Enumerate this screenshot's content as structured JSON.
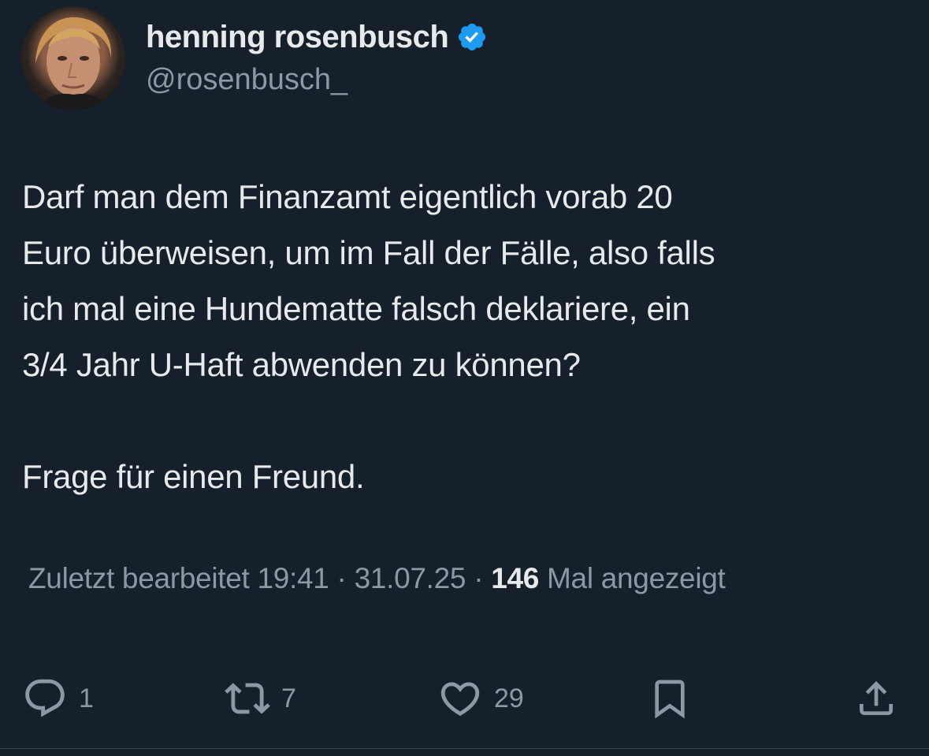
{
  "author": {
    "display_name": "henning rosenbusch",
    "handle": "@rosenbusch_",
    "verified_icon": "verified-badge-icon",
    "badge_color": "#1d9bf0"
  },
  "tweet": {
    "text": "Darf man dem Finanzamt eigentlich vorab 20\nEuro überweisen, um im Fall der Fälle, also falls\nich mal eine Hundematte falsch deklariere, ein\n3/4 Jahr U-Haft abwenden zu können?\n\nFrage für einen Freund."
  },
  "meta": {
    "edited_label": "Zuletzt bearbeitet",
    "time": "19:41",
    "date": "31.07.25",
    "views_count": "146",
    "views_label": "Mal angezeigt"
  },
  "actions": {
    "reply_count": "1",
    "retweet_count": "7",
    "like_count": "29"
  },
  "colors": {
    "background": "#15202b",
    "text": "#e7e9ea",
    "secondary_text": "#8b98a5"
  }
}
